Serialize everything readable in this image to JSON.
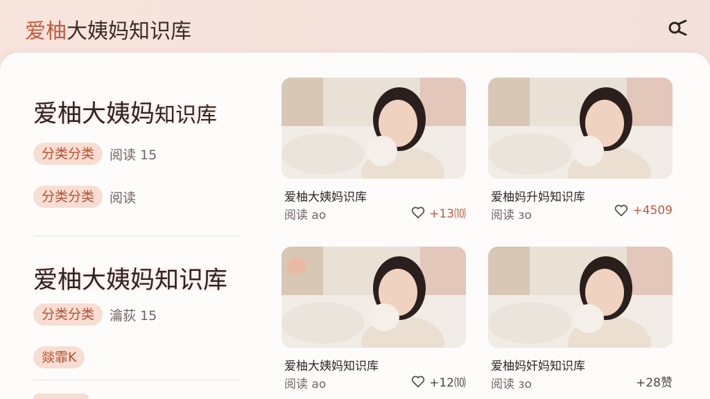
{
  "header": {
    "title_brand": "爱柚",
    "title_rest": "大姨妈知识库"
  },
  "articles": [
    {
      "title_main": "爱柚大姨妈",
      "title_small": "知识库",
      "rows": [
        {
          "category": "分类分类",
          "reads": "阅读 15"
        },
        {
          "category": "分类分类",
          "reads": "阅读"
        }
      ]
    },
    {
      "title_main": "爱柚大姨妈知识库",
      "title_small": "",
      "rows": [
        {
          "category": "分类分类",
          "reads": "瀹荻 15"
        },
        {
          "category": "燚霏K",
          "reads": ""
        }
      ]
    }
  ],
  "cards": [
    {
      "title": "爱柚大姨妈识库",
      "reads": "阅读 ao",
      "likes": "+13⑽",
      "highlight": true
    },
    {
      "title": "爱柚妈升妈知识库",
      "reads": "阅读 ɜo",
      "likes": "+4509",
      "highlight": true
    },
    {
      "title": "爱柚大姨妈知识库",
      "reads": "阅读 ao",
      "likes": "+12⑽",
      "highlight": false
    },
    {
      "title": "爱柚妈奸妈知识库",
      "reads": "阅读 ɜo",
      "likes": "+28赞",
      "highlight": false
    }
  ],
  "colors": {
    "accent": "#c65a3e",
    "pill_bg": "#f8ddd3",
    "panel_bg": "#fefcfb"
  },
  "icons": {
    "close": "close-icon",
    "heart": "heart-icon"
  }
}
